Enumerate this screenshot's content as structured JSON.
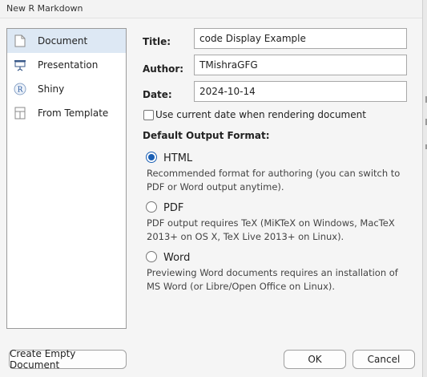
{
  "window": {
    "title": "New R Markdown"
  },
  "sidebar": {
    "items": [
      {
        "label": "Document",
        "icon": "document-icon",
        "selected": true
      },
      {
        "label": "Presentation",
        "icon": "presentation-icon",
        "selected": false
      },
      {
        "label": "Shiny",
        "icon": "shiny-r-icon",
        "selected": false
      },
      {
        "label": "From Template",
        "icon": "template-icon",
        "selected": false
      }
    ]
  },
  "form": {
    "title_label": "Title:",
    "title_value": "code Display Example",
    "author_label": "Author:",
    "author_value": "TMishraGFG",
    "date_label": "Date:",
    "date_value": "2024-10-14",
    "use_current_date_label": "Use current date when rendering document",
    "use_current_date_checked": false
  },
  "output_format": {
    "heading": "Default Output Format:",
    "selected": "HTML",
    "options": [
      {
        "label": "HTML",
        "description": "Recommended format for authoring (you can switch to PDF or Word output anytime)."
      },
      {
        "label": "PDF",
        "description": "PDF output requires TeX (MiKTeX on Windows, MacTeX 2013+ on OS X, TeX Live 2013+ on Linux)."
      },
      {
        "label": "Word",
        "description": "Previewing Word documents requires an installation of MS Word (or Libre/Open Office on Linux)."
      }
    ]
  },
  "buttons": {
    "create_empty": "Create Empty Document",
    "ok": "OK",
    "cancel": "Cancel"
  },
  "colors": {
    "accent": "#1a5fb4",
    "selection": "#dde8f4",
    "dialog_bg": "#f5f5f5"
  }
}
